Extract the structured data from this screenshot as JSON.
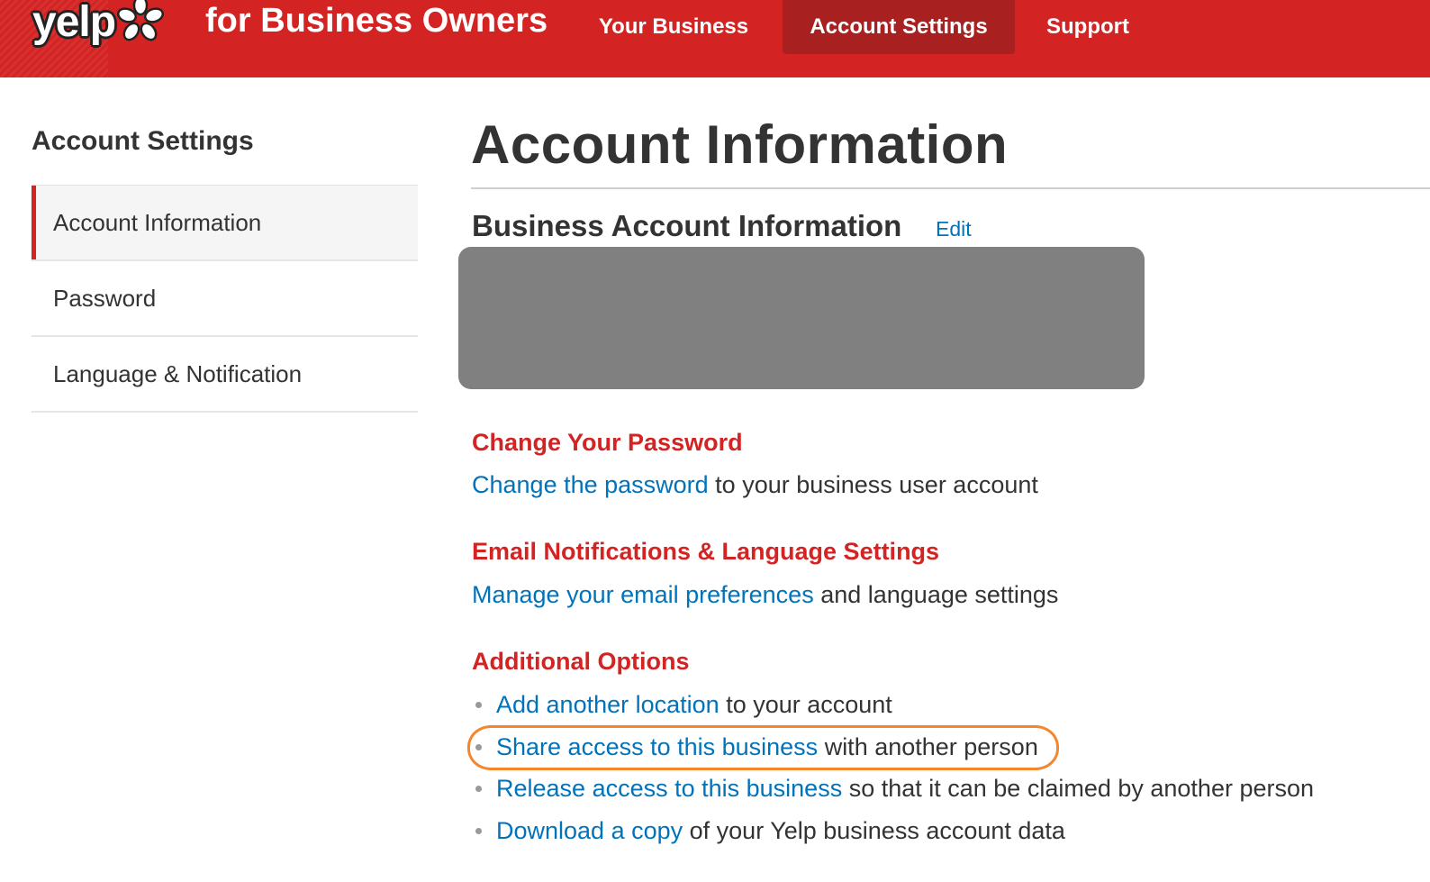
{
  "header": {
    "logo_text": "yelp",
    "brand_tagline": "for Business Owners",
    "nav": [
      {
        "label": "Your Business",
        "active": false
      },
      {
        "label": "Account Settings",
        "active": true
      },
      {
        "label": "Support",
        "active": false
      }
    ]
  },
  "sidebar": {
    "title": "Account Settings",
    "items": [
      {
        "label": "Account Information",
        "active": true
      },
      {
        "label": "Password",
        "active": false
      },
      {
        "label": "Language & Notification",
        "active": false
      }
    ]
  },
  "main": {
    "page_title": "Account Information",
    "business_account": {
      "title": "Business Account Information",
      "edit_label": "Edit"
    },
    "sections": {
      "password": {
        "heading": "Change Your Password",
        "link": "Change the password",
        "text": " to your business user account"
      },
      "email": {
        "heading": "Email Notifications & Language Settings",
        "link": "Manage your email preferences",
        "text": " and language settings"
      },
      "additional": {
        "heading": "Additional Options",
        "items": [
          {
            "link": "Add another location",
            "text": " to your account"
          },
          {
            "link": "Share access to this business",
            "text": " with another person"
          },
          {
            "link": "Release access to this business",
            "text": " so that it can be claimed by another person"
          },
          {
            "link": "Download a copy",
            "text": " of your Yelp business account data"
          }
        ]
      }
    }
  },
  "colors": {
    "brand_red": "#d32323",
    "active_nav_bg": "#a82020",
    "link_blue": "#0073bb",
    "highlight_orange": "#f5862b",
    "redacted_gray": "#808080"
  },
  "icons": {
    "logo_burst": "yelp-burst-icon"
  }
}
